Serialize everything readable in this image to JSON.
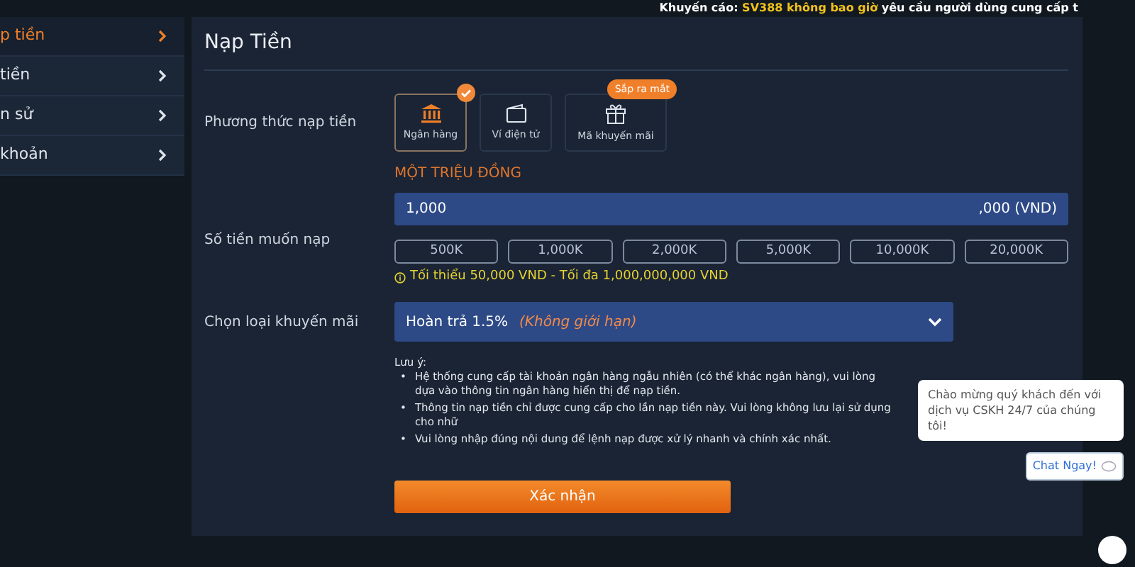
{
  "notice": {
    "label": "Khuyến cáo:",
    "highlight": "SV388 không bao giờ",
    "text": "yêu cầu người dùng cung cấp t"
  },
  "sidebar": {
    "items": [
      {
        "label": "p tiền",
        "selected": true
      },
      {
        "label": "tiền",
        "selected": false
      },
      {
        "label": "n sử",
        "selected": false
      },
      {
        "label": "khoản",
        "selected": false
      }
    ]
  },
  "panel": {
    "title": "Nạp Tiền",
    "method": {
      "label": "Phương thức nạp tiền",
      "options": [
        {
          "label": "Ngân hàng",
          "kind": "bank",
          "selected": true
        },
        {
          "label": "Ví điện tử",
          "kind": "wallet",
          "selected": false
        },
        {
          "label": "Mã khuyến mãi",
          "kind": "gift",
          "selected": false,
          "badge": "Sắp ra mắt"
        }
      ]
    },
    "amount_words": "MỘT TRIỆU ĐỒNG",
    "amount": {
      "label": "Số tiền muốn nạp",
      "value": "1,000",
      "suffix": ",000 (VND)"
    },
    "presets": [
      "500K",
      "1,000K",
      "2,000K",
      "5,000K",
      "10,000K",
      "20,000K"
    ],
    "limit_hint": "Tối thiểu 50,000 VND - Tối đa 1,000,000,000 VND",
    "promotion": {
      "label": "Chọn loại khuyến mãi",
      "value": "Hoàn trả 1.5%",
      "note": "(Không giới hạn)"
    },
    "notes": {
      "title": "Lưu ý:",
      "marker": "•",
      "items": [
        "Hệ thống cung cấp tài khoản ngân hàng ngẫu nhiên (có thể khác ngân hàng), vui lòng dựa vào thông tin ngân hàng hiển thị để nạp tiền.",
        "Thông tin nạp tiền chỉ được cung cấp cho lần nạp tiền này. Vui lòng không lưu lại sử dụng cho nhữ",
        "Vui lòng nhập đúng nội dung để lệnh nạp được xử lý nhanh và chính xác nhất."
      ]
    },
    "submit": "Xác nhận"
  },
  "chat": {
    "message": "Chào mừng quý khách đến với dịch vụ CSKH 24/7 của chúng tôi!",
    "button": "Chat Ngay!"
  }
}
